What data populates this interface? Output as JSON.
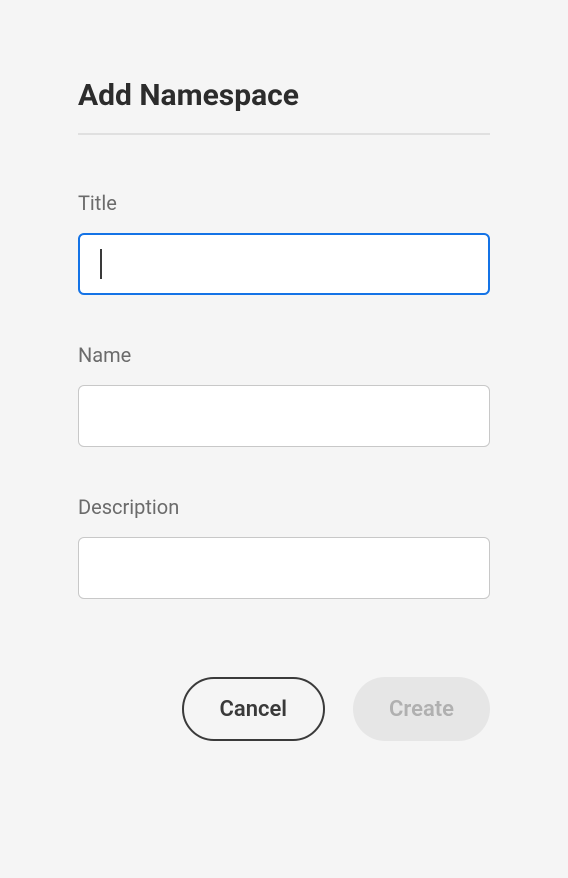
{
  "dialog": {
    "title": "Add Namespace"
  },
  "form": {
    "title": {
      "label": "Title",
      "value": ""
    },
    "name": {
      "label": "Name",
      "value": ""
    },
    "description": {
      "label": "Description",
      "value": ""
    }
  },
  "buttons": {
    "cancel": "Cancel",
    "create": "Create"
  }
}
